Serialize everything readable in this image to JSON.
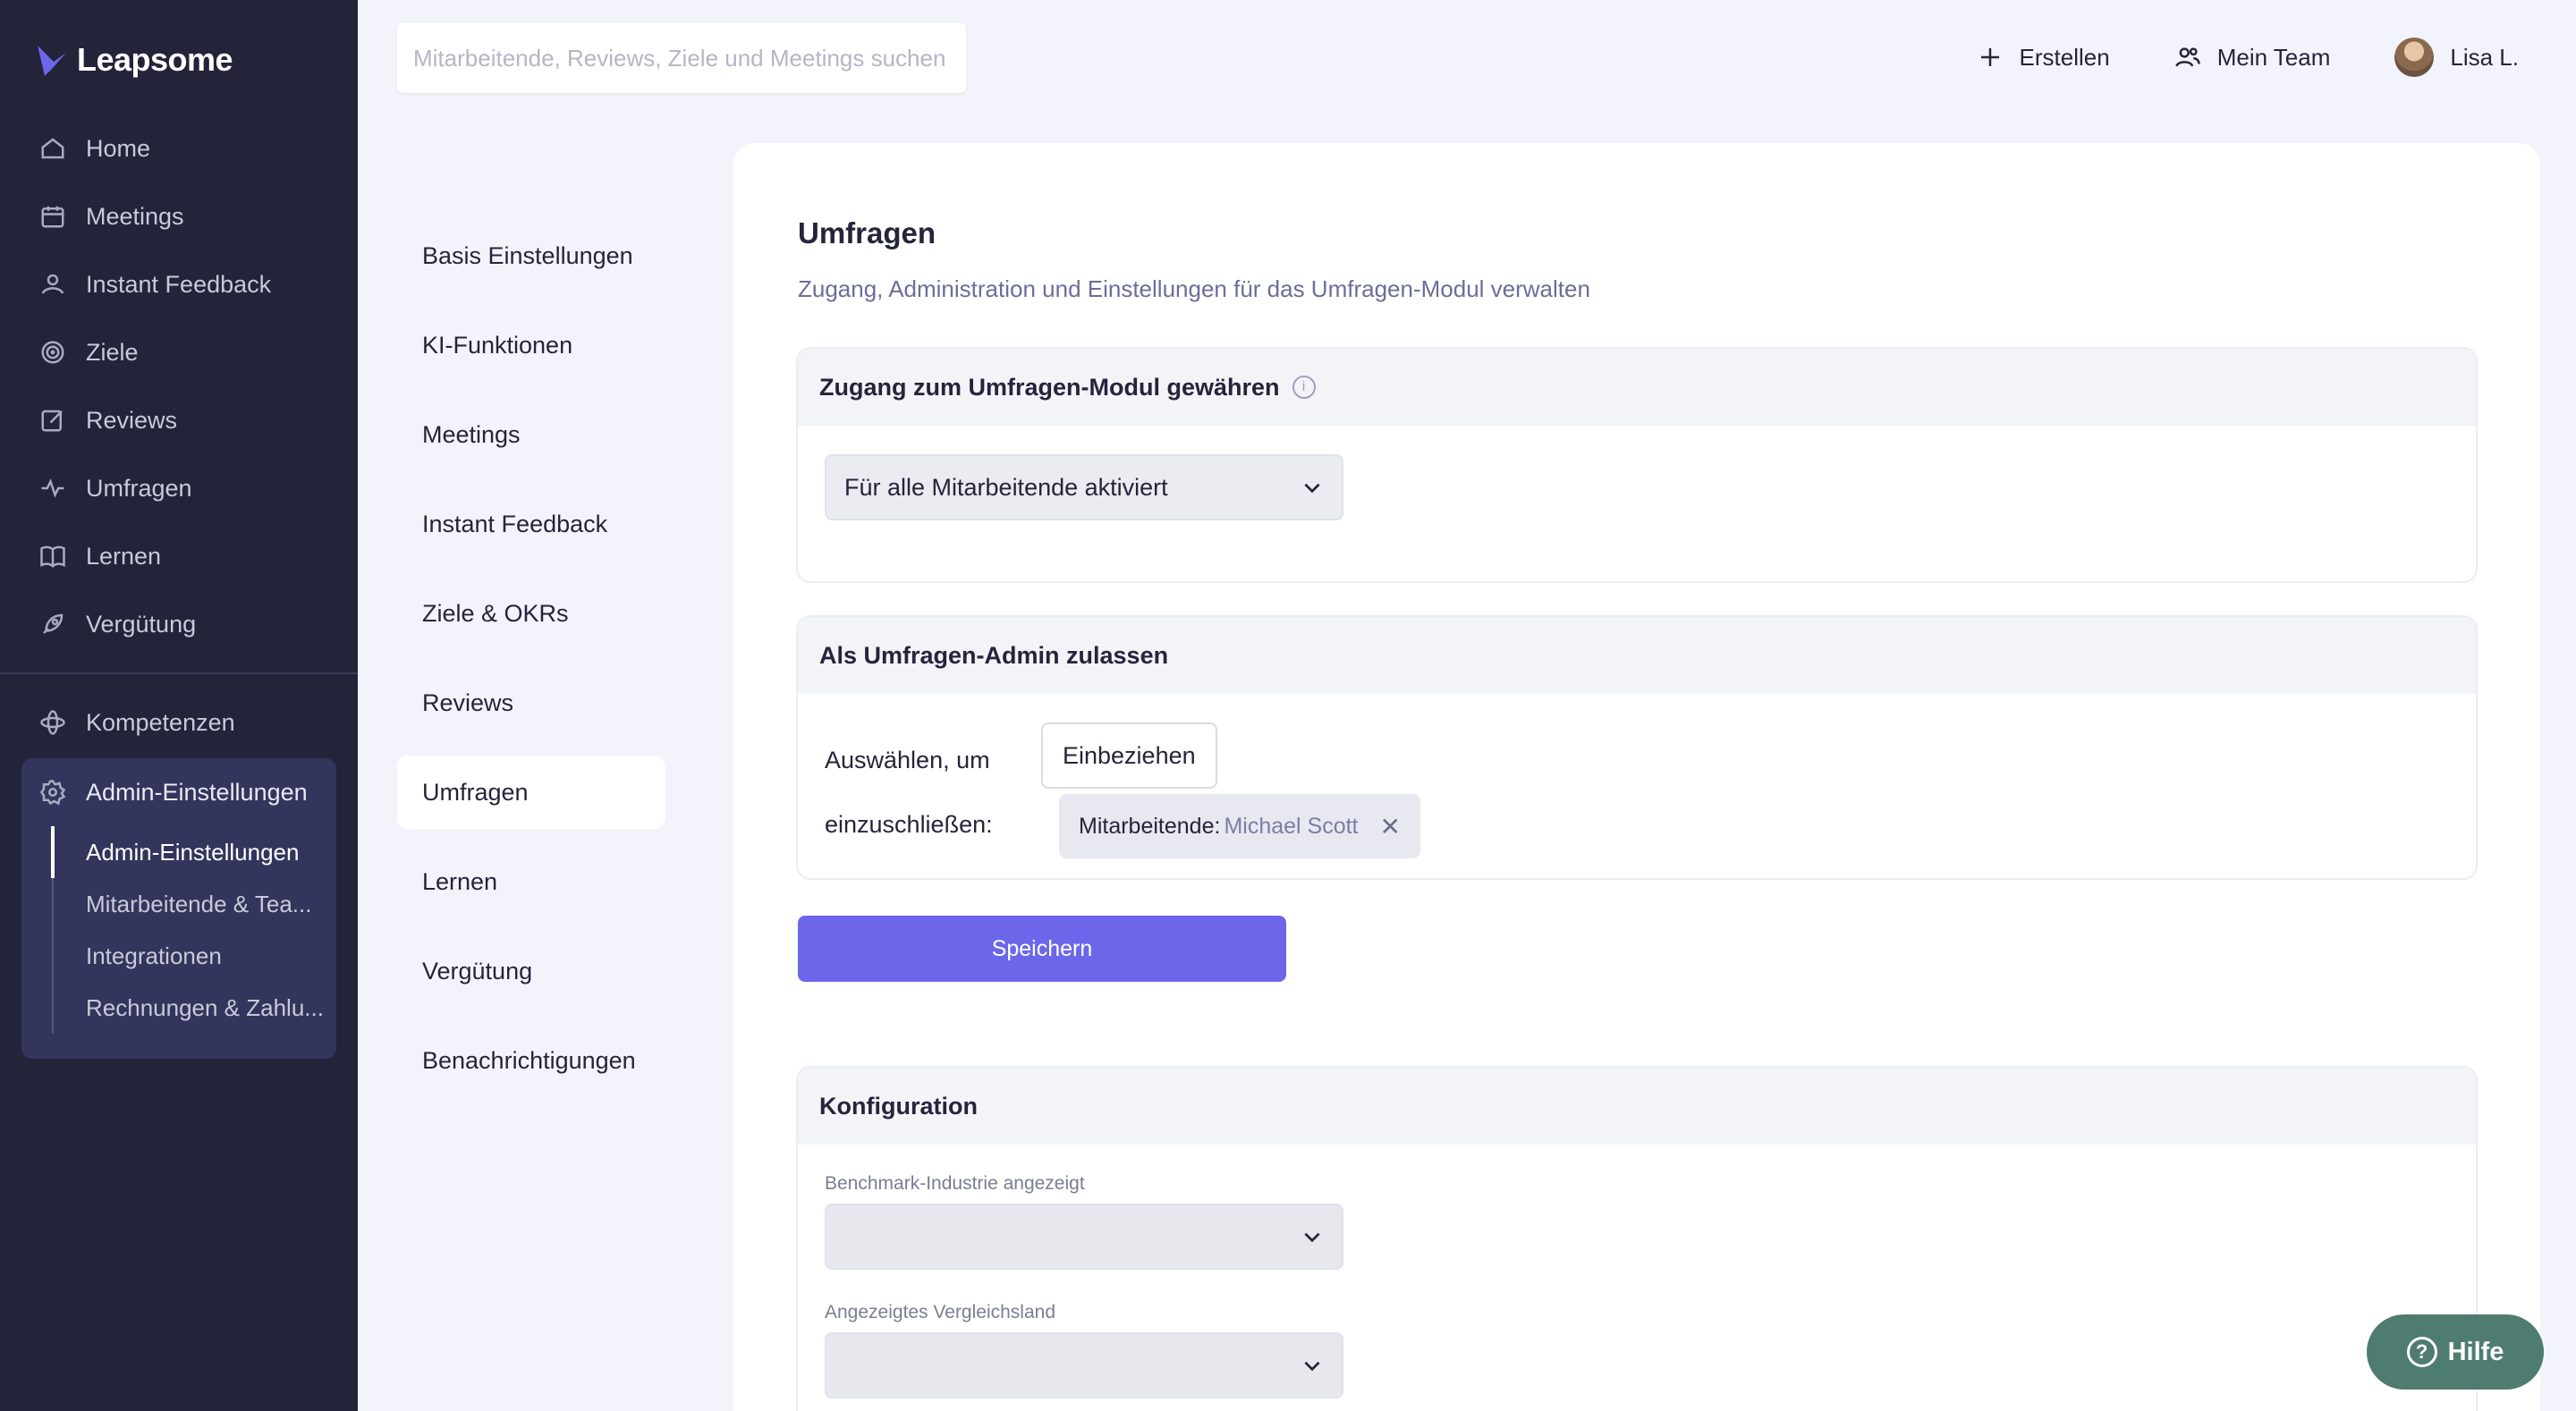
{
  "app": {
    "logo_text": "Leapsome"
  },
  "sidebar": {
    "items": [
      {
        "label": "Home",
        "icon": "home-icon"
      },
      {
        "label": "Meetings",
        "icon": "calendar-icon"
      },
      {
        "label": "Instant Feedback",
        "icon": "feedback-icon"
      },
      {
        "label": "Ziele",
        "icon": "target-icon"
      },
      {
        "label": "Reviews",
        "icon": "edit-icon"
      },
      {
        "label": "Umfragen",
        "icon": "pulse-icon"
      },
      {
        "label": "Lernen",
        "icon": "book-icon"
      },
      {
        "label": "Vergütung",
        "icon": "rocket-icon"
      }
    ],
    "kompetenzen": "Kompetenzen",
    "admin": {
      "label": "Admin-Einstellungen",
      "sub": [
        "Admin-Einstellungen",
        "Mitarbeitende & Tea...",
        "Integrationen",
        "Rechnungen & Zahlu..."
      ]
    }
  },
  "topbar": {
    "search_placeholder": "Mitarbeitende, Reviews, Ziele und Meetings suchen",
    "create": "Erstellen",
    "team": "Mein Team",
    "user": "Lisa L."
  },
  "settings_menu": [
    "Basis Einstellungen",
    "KI-Funktionen",
    "Meetings",
    "Instant Feedback",
    "Ziele & OKRs",
    "Reviews",
    "Umfragen",
    "Lernen",
    "Vergütung",
    "Benachrichtigungen"
  ],
  "main": {
    "title": "Umfragen",
    "subtitle": "Zugang, Administration und Einstellungen für das Umfragen-Modul verwalten",
    "access": {
      "title": "Zugang zum Umfragen-Modul gewähren",
      "select_value": "Für alle Mitarbeitende aktiviert"
    },
    "admin": {
      "title": "Als Umfragen-Admin zulassen",
      "label_line1": "Auswählen, um",
      "label_line2": "einzuschließen:",
      "include_button": "Einbeziehen",
      "chip_key": "Mitarbeitende:",
      "chip_value": "Michael Scott"
    },
    "save": "Speichern",
    "config": {
      "title": "Konfiguration",
      "benchmark_label": "Benchmark-Industrie angezeigt",
      "country_label": "Angezeigtes Vergleichsland"
    }
  },
  "help": "Hilfe"
}
